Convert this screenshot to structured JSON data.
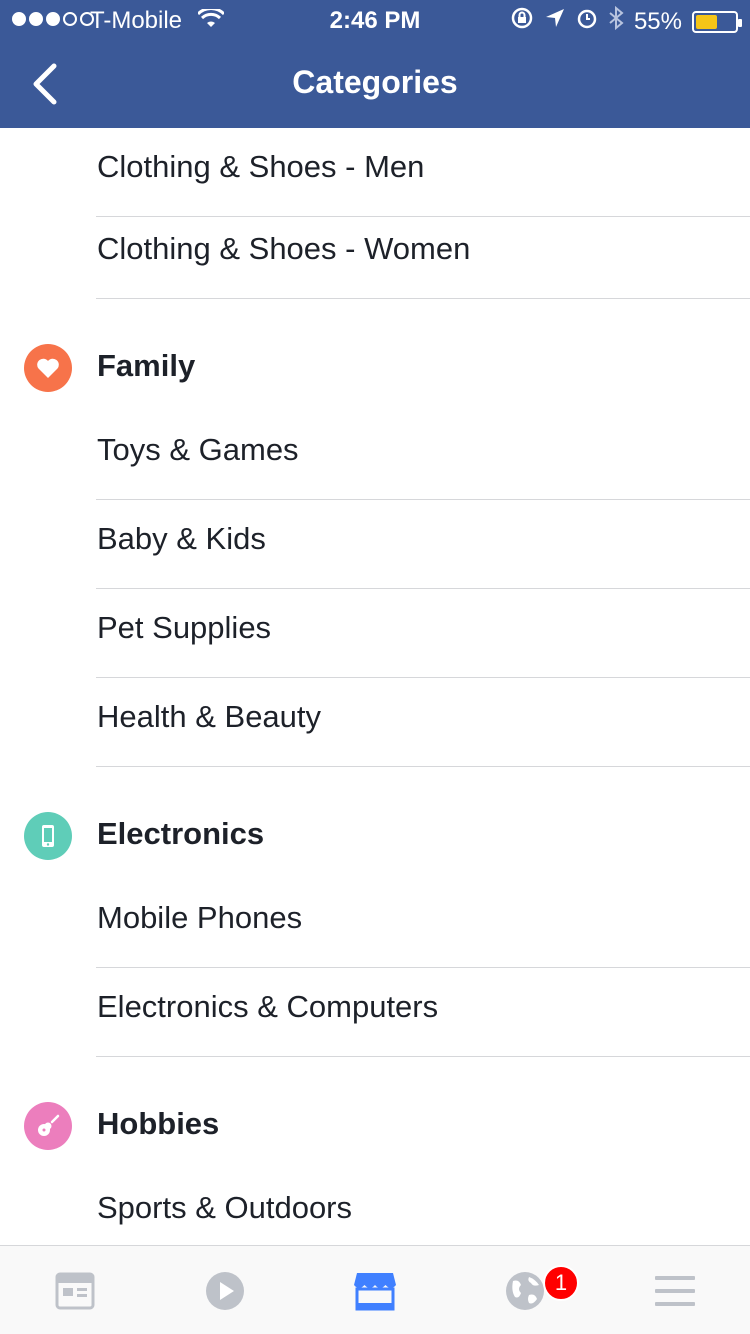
{
  "status_bar": {
    "carrier": "T-Mobile",
    "time": "2:46 PM",
    "battery_percent": "55%",
    "battery_level": 0.55,
    "signal_bars_filled": 3,
    "signal_bars_total": 5
  },
  "nav": {
    "title": "Categories",
    "back_icon": "chevron-left-icon"
  },
  "list": {
    "clothing": [
      "Clothing & Shoes - Men",
      "Clothing & Shoes - Women"
    ],
    "family": {
      "label": "Family",
      "icon": "heart-icon",
      "color": "#f7734a",
      "items": [
        "Toys & Games",
        "Baby & Kids",
        "Pet Supplies",
        "Health & Beauty"
      ]
    },
    "electronics": {
      "label": "Electronics",
      "icon": "mobile-phone-icon",
      "color": "#5fcdb8",
      "items": [
        "Mobile Phones",
        "Electronics & Computers"
      ]
    },
    "hobbies": {
      "label": "Hobbies",
      "icon": "guitar-icon",
      "color": "#ec7ebd",
      "items": [
        "Sports & Outdoors"
      ]
    }
  },
  "tabbar": {
    "tabs": [
      "news-feed-icon",
      "video-icon",
      "marketplace-icon",
      "notifications-globe-icon",
      "menu-icon"
    ],
    "active_tab": "marketplace-icon",
    "notification_badge": "1"
  },
  "colors": {
    "brand": "#3b5998",
    "active_tab": "#4080ff",
    "inactive_tab": "#bec2c9",
    "badge": "#ff0000"
  }
}
